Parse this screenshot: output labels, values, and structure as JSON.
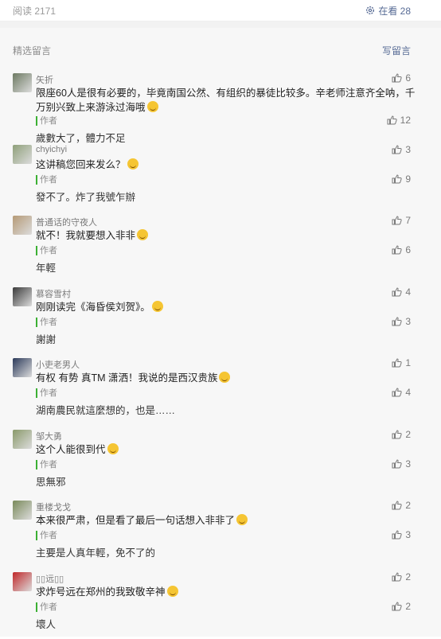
{
  "header": {
    "read_label": "阅读 2171",
    "watching_label": "在看 28"
  },
  "section": {
    "title": "精选留言",
    "write_label": "写留言"
  },
  "author_tag": "作者",
  "comments": [
    {
      "nick": "矢折",
      "text": "限座60人是很有必要的，毕竟南国公然、有组织的暴徒比较多。辛老师注意齐全呐，千万别兴致上来游泳过海哦",
      "likes": "6",
      "reply": "歲數大了，體力不足",
      "reply_likes": "12",
      "avatar_color": "#6d7a62"
    },
    {
      "nick": "chyichyi",
      "text": "这讲稿您回来发么？",
      "likes": "3",
      "reply": "發不了。炸了我號乍辦",
      "reply_likes": "9",
      "avatar_color": "#8fa07a"
    },
    {
      "nick": "普通话的守夜人",
      "text": "就不！我就要想入非非",
      "likes": "7",
      "reply": "年輕",
      "reply_likes": "6",
      "avatar_color": "#b59a76"
    },
    {
      "nick": "慕容雪村",
      "text": "刚刚读完《海昏侯刘贺》。",
      "likes": "4",
      "reply": "謝謝",
      "reply_likes": "3",
      "avatar_color": "#3b3b3b"
    },
    {
      "nick": "小吏老男人",
      "text": "有权 有势 真TM 潇洒！我说的是西汉贵族",
      "likes": "1",
      "reply": "湖南農民就這麼想的，也是……",
      "reply_likes": "4",
      "avatar_color": "#2c3a5a"
    },
    {
      "nick": "邹大勇",
      "text": "这个人能很到代",
      "likes": "2",
      "reply": "思無邪",
      "reply_likes": "3",
      "avatar_color": "#8a9a6a"
    },
    {
      "nick": "重楼戈戈",
      "text": "本来很严肃，但是看了最后一句话想入非非了",
      "likes": "2",
      "reply": "主要是人真年輕，免不了的",
      "reply_likes": "3",
      "avatar_color": "#7a8a5a"
    },
    {
      "nick": "▯▯远▯▯",
      "text": "求炸号远在郑州的我致敬辛神",
      "likes": "2",
      "reply": "壞人",
      "reply_likes": "2",
      "avatar_color": "#c0282a"
    }
  ]
}
